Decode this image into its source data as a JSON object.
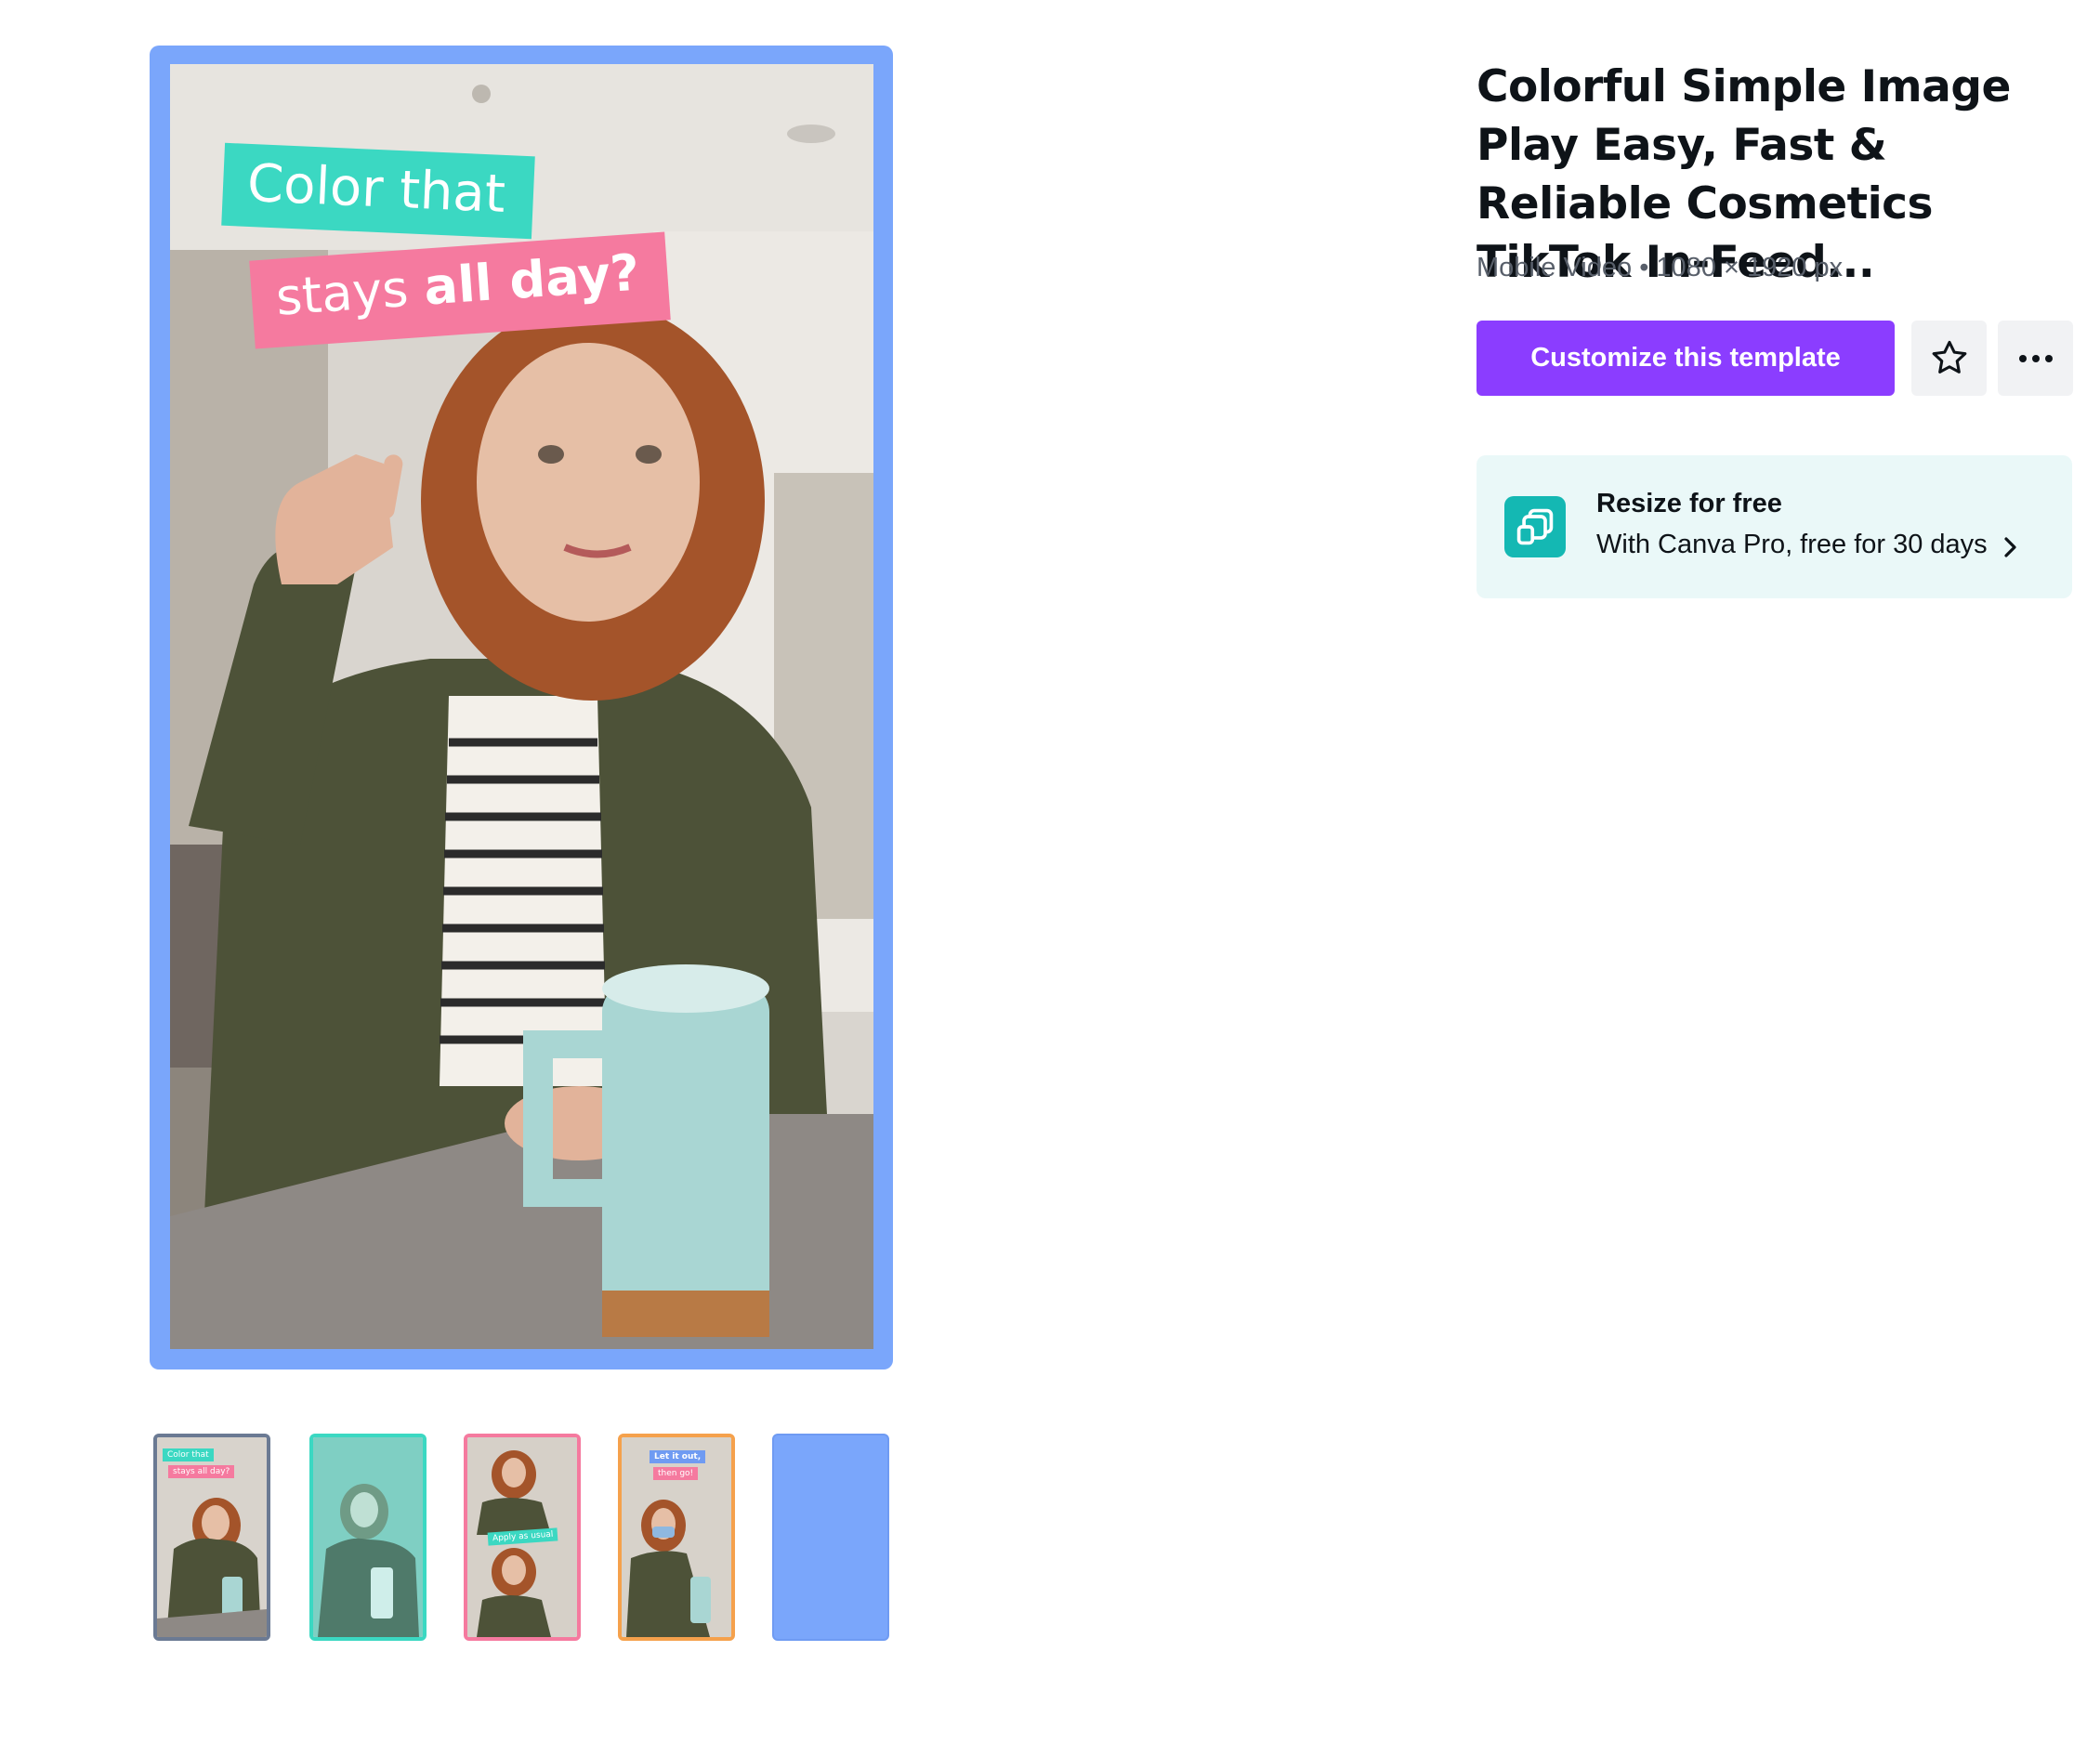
{
  "preview": {
    "caption_line1": "Color that",
    "caption_line2_regular": "stays ",
    "caption_line2_bold": "all day?"
  },
  "thumbnails": [
    {
      "label_1": "Color that",
      "label_2": "stays all day?"
    },
    {},
    {
      "label": "Apply as usual"
    },
    {
      "label_1": "Let it out,",
      "label_2": "then go!"
    },
    {}
  ],
  "template": {
    "title": "Colorful Simple Image Play Easy, Fast & Reliable Cosmetics TikTok In-Feed...",
    "meta": "Mobile Video • 1080 × 1920 px"
  },
  "actions": {
    "customize_label": "Customize this template",
    "favorite_icon": "star-icon",
    "more_icon": "more-horizontal-icon"
  },
  "promo": {
    "icon": "resize-icon",
    "title": "Resize for free",
    "subtitle": "With Canva Pro, free for 30 days"
  },
  "colors": {
    "accent_purple": "#8b3dff",
    "preview_frame": "#7aa6fb",
    "promo_bg": "#eaf8f8",
    "promo_icon": "#14b8b3",
    "caption_teal": "#3bd8c2",
    "caption_pink": "#f57a9f"
  }
}
